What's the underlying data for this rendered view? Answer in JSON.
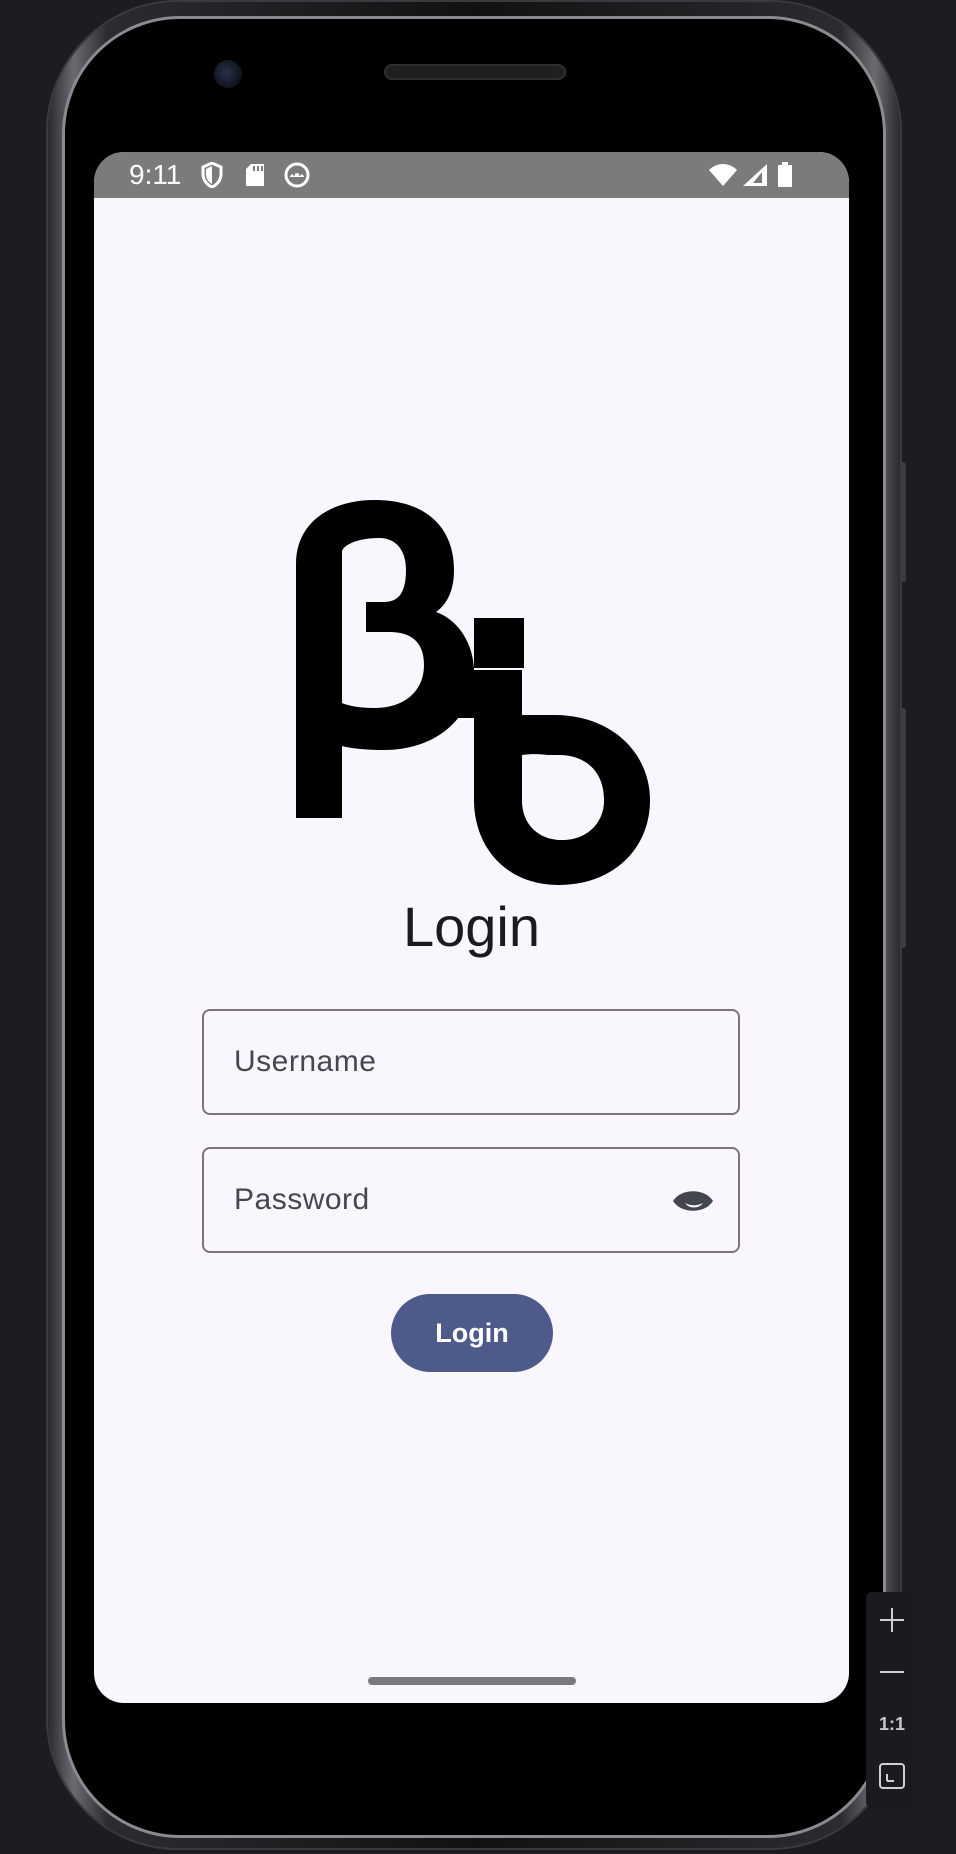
{
  "status_bar": {
    "time": "9:11",
    "left_icons": [
      "shield-icon",
      "sd-card-icon",
      "android-debug-icon"
    ],
    "right_icons": [
      "wifi-icon",
      "cellular-signal-icon",
      "battery-icon"
    ]
  },
  "screen": {
    "logo_icon": "beta-b-logo",
    "title": "Login",
    "username_placeholder": "Username",
    "password_placeholder": "Password",
    "password_toggle_icon": "eye-icon",
    "login_button_label": "Login"
  },
  "emulator_toolbar": {
    "zoom_in_icon": "plus-icon",
    "zoom_out_icon": "minus-icon",
    "actual_size_label": "1:1",
    "fit_screen_icon": "fit-screen-icon"
  },
  "colors": {
    "screen_background": "#f9f6fd",
    "status_bar": "#7b7b7b",
    "primary_button": "#4e5b8a",
    "field_outline": "#79747e",
    "text_primary": "#1b1b1f"
  }
}
